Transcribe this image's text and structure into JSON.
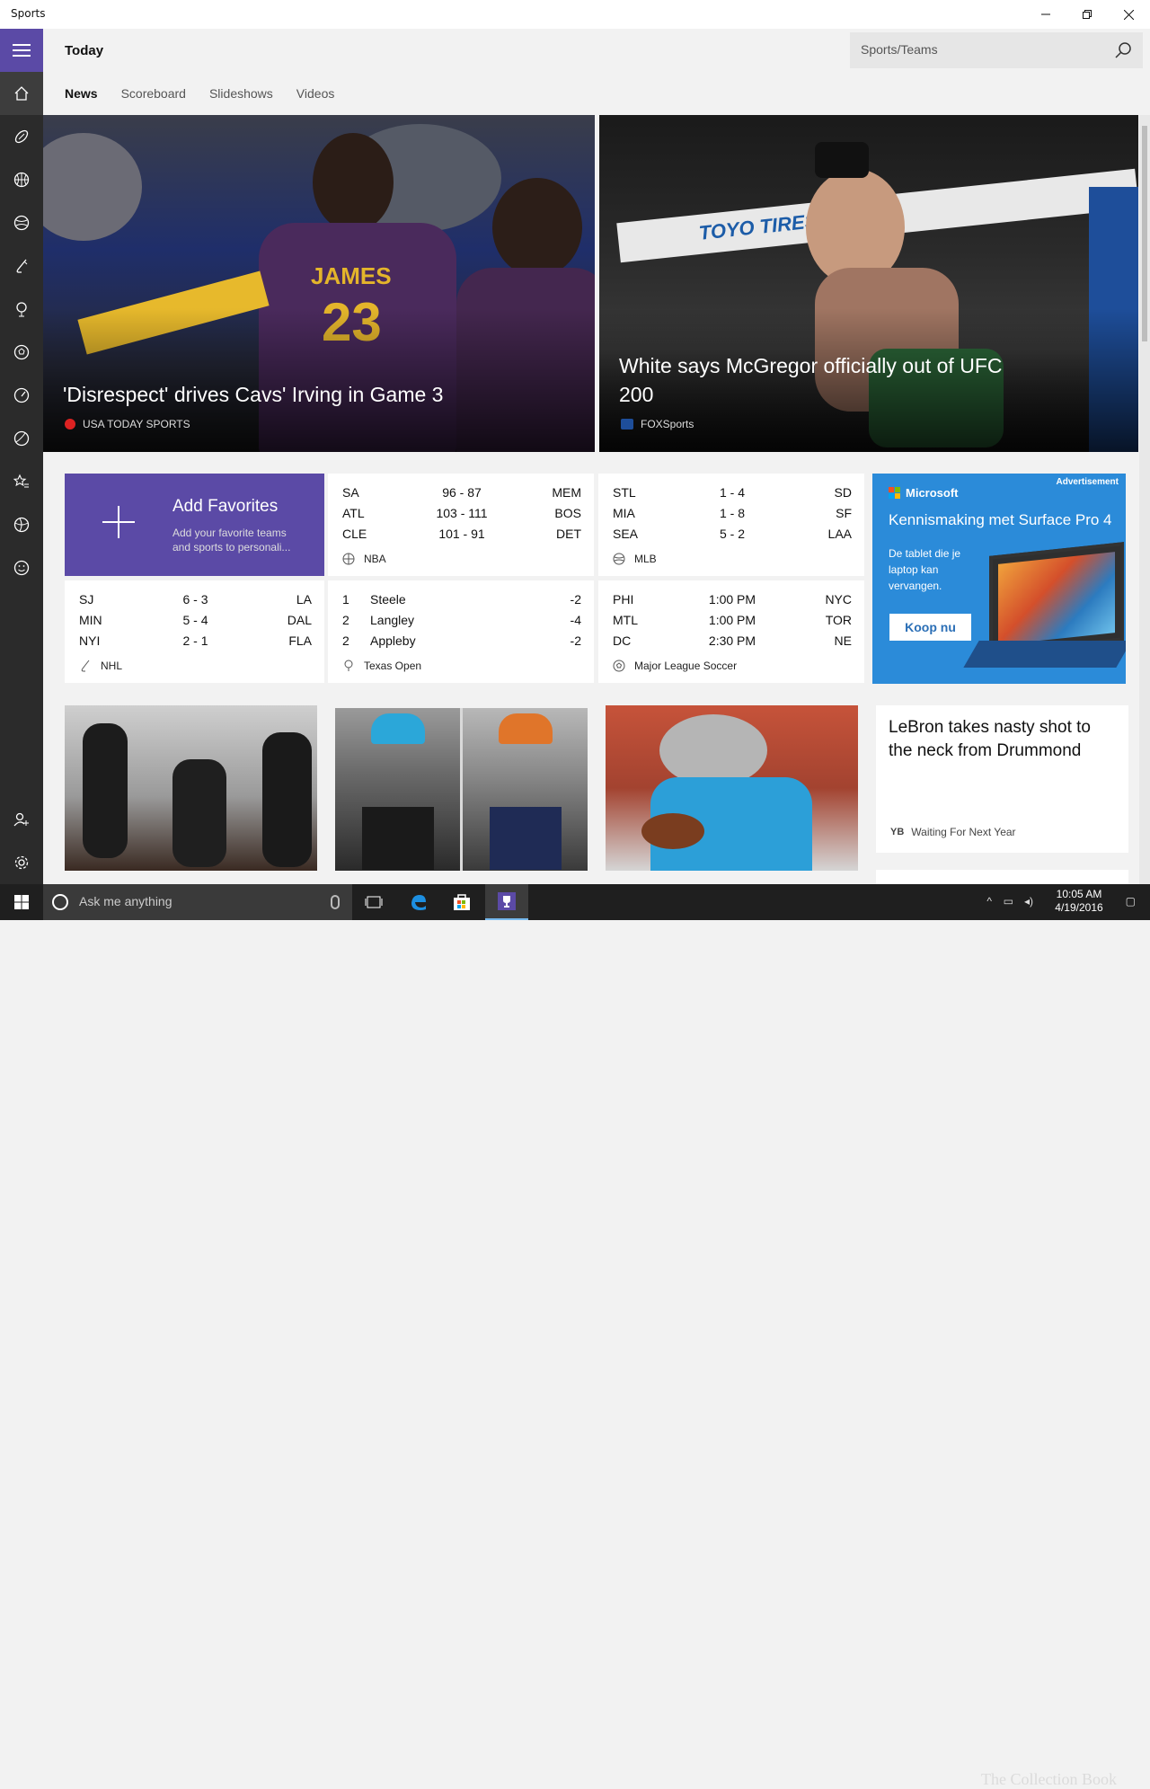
{
  "window": {
    "title": "Sports"
  },
  "header": {
    "page_title": "Today",
    "search_placeholder": "Sports/Teams",
    "tabs": [
      "News",
      "Scoreboard",
      "Slideshows",
      "Videos"
    ]
  },
  "hero": [
    {
      "headline": "'Disrespect' drives Cavs' Irving in Game 3",
      "source": "USA TODAY SPORTS",
      "jersey_text": "JAMES",
      "jersey_number": "23"
    },
    {
      "headline": "White says McGregor officially out of UFC 200",
      "source": "FOXSports",
      "banner_text": "TOYO TIRES"
    }
  ],
  "favorites": {
    "title": "Add Favorites",
    "subtitle": "Add your favorite teams and sports to personali..."
  },
  "scores": {
    "nba": {
      "league": "NBA",
      "rows": [
        [
          "SA",
          "96  -  87",
          "MEM"
        ],
        [
          "ATL",
          "103  -  111",
          "BOS"
        ],
        [
          "CLE",
          "101  -  91",
          "DET"
        ]
      ]
    },
    "mlb": {
      "league": "MLB",
      "rows": [
        [
          "STL",
          "1  -  4",
          "SD"
        ],
        [
          "MIA",
          "1  -  8",
          "SF"
        ],
        [
          "SEA",
          "5  -  2",
          "LAA"
        ]
      ]
    },
    "nhl": {
      "league": "NHL",
      "rows": [
        [
          "SJ",
          "6  -  3",
          "LA"
        ],
        [
          "MIN",
          "5  -  4",
          "DAL"
        ],
        [
          "NYI",
          "2  -  1",
          "FLA"
        ]
      ]
    },
    "golf": {
      "league": "Texas Open",
      "rows": [
        [
          "1",
          "Steele",
          "-2"
        ],
        [
          "2",
          "Langley",
          "-4"
        ],
        [
          "2",
          "Appleby",
          "-2"
        ]
      ]
    },
    "mls": {
      "league": "Major League Soccer",
      "rows": [
        [
          "PHI",
          "1:00 PM",
          "NYC"
        ],
        [
          "MTL",
          "1:00 PM",
          "TOR"
        ],
        [
          "DC",
          "2:30 PM",
          "NE"
        ]
      ]
    }
  },
  "ad": {
    "label": "Advertisement",
    "brand": "Microsoft",
    "headline": "Kennismaking met Surface Pro 4",
    "body": "De tablet die je laptop kan vervangen.",
    "button": "Koop nu"
  },
  "news_card": {
    "headline": "LeBron takes nasty shot to the neck from Drummond",
    "source_badge": "YB",
    "source": "Waiting For Next Year"
  },
  "taskbar": {
    "search_placeholder": "Ask me anything",
    "time": "10:05 AM",
    "date": "4/19/2016",
    "watermark": "The Collection Book"
  },
  "colors": {
    "accent": "#5b4aa6",
    "nav_bg": "#2b2b2b",
    "ad_blue": "#2b8bd9"
  }
}
